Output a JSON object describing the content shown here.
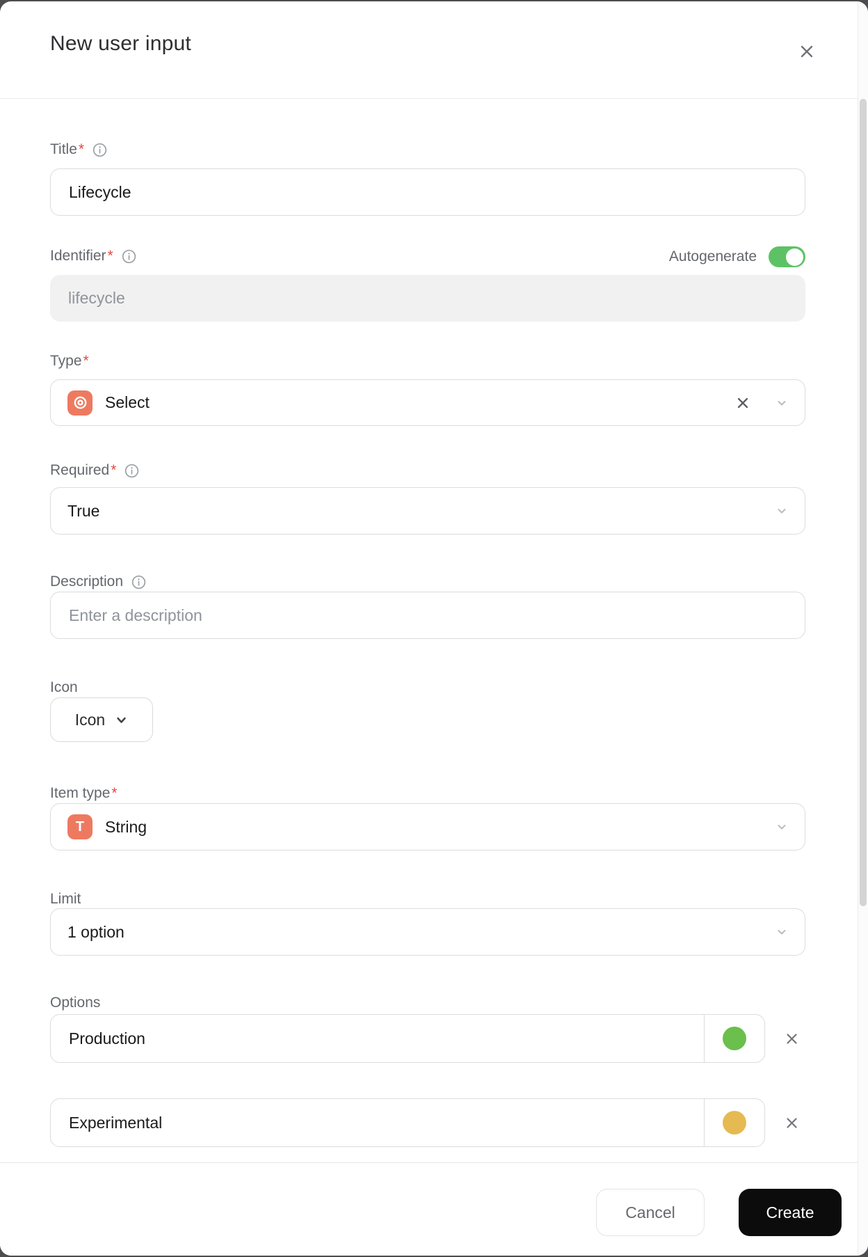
{
  "dialog": {
    "title": "New user input"
  },
  "marks": {
    "required": "*"
  },
  "colors": {
    "toggle_on": "#5dc264",
    "type_icon_bg": "#ed7a60",
    "item_type_icon_bg": "#ed7a60",
    "create_button_bg": "#0c0c0d",
    "option_colors": [
      "#6abf4d",
      "#e6ba52"
    ]
  },
  "fields": {
    "title": {
      "label": "Title",
      "value": "Lifecycle"
    },
    "identifier": {
      "label": "Identifier",
      "toggle_label": "Autogenerate",
      "toggle_state": "on",
      "placeholder": "lifecycle"
    },
    "type": {
      "label": "Type",
      "value": "Select"
    },
    "required": {
      "label": "Required",
      "value": "True"
    },
    "description": {
      "label": "Description",
      "placeholder": "Enter a description"
    },
    "icon": {
      "label": "Icon",
      "button_label": "Icon"
    },
    "item_type": {
      "label": "Item type",
      "icon_letter": "T",
      "value": "String"
    },
    "limit": {
      "label": "Limit",
      "value": "1 option"
    },
    "options": {
      "label": "Options",
      "items": [
        {
          "value": "Production",
          "color": "#6abf4d"
        },
        {
          "value": "Experimental",
          "color": "#e6ba52"
        }
      ]
    }
  },
  "footer": {
    "cancel_label": "Cancel",
    "create_label": "Create"
  }
}
